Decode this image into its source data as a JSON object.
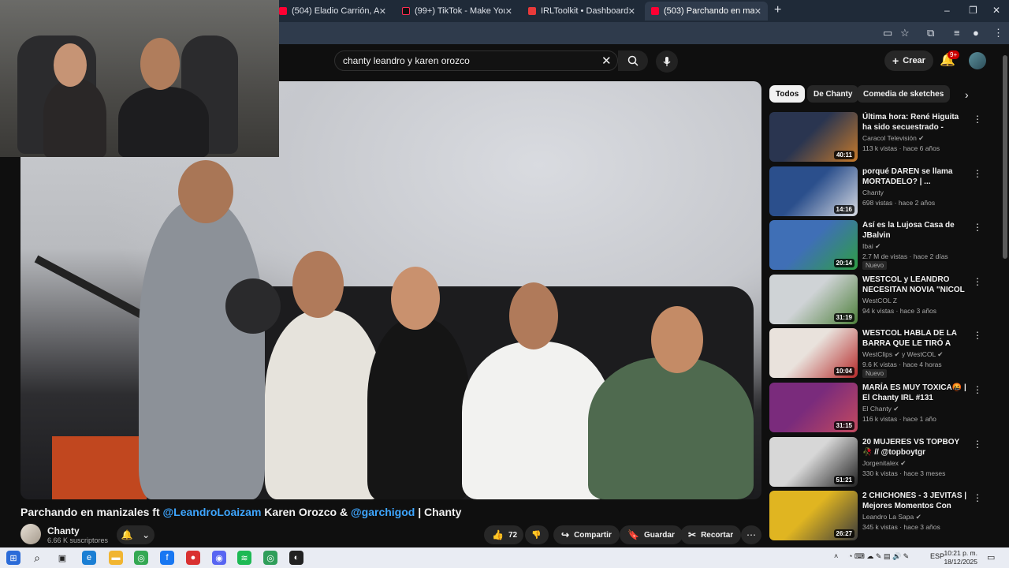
{
  "browser": {
    "tabs": [
      {
        "title": "(504) Eladio Carrión, Arcángel",
        "active": false
      },
      {
        "title": "(99+) TikTok - Make Your Day",
        "active": false
      },
      {
        "title": "IRLToolkit • Dashboard",
        "active": false
      },
      {
        "title": "(503) Parchando en manizales",
        "active": true
      }
    ],
    "new_tab": "+",
    "min": "–",
    "restore": "❐",
    "close": "✕"
  },
  "youtube": {
    "search_query": "chanty leandro y karen orozco",
    "create_label": "Crear",
    "notifications_badge": "9+",
    "video": {
      "title_prefix": "Parchando en manizales ft ",
      "mention1": "@LeandroLoaizam",
      "title_mid": " Karen Orozco & ",
      "mention2": "@garchigod",
      "title_suffix": " | Chanty",
      "channel": "Chanty",
      "subscribers": "6.66 K suscriptores",
      "likes": "72",
      "share_label": "Compartir",
      "save_label": "Guardar",
      "clip_label": "Recortar"
    },
    "chips": [
      "Todos",
      "De Chanty",
      "Comedia de sketches"
    ],
    "recommendations": [
      {
        "title": "Última hora: René Higuita ha sido secuestrado  - Capítulo 3...",
        "channel": "Caracol Televisión ✔",
        "meta": "113 k vistas · hace 6 años",
        "duration": "40:11",
        "badge": "",
        "colors": [
          "#2a3550",
          "#c77a2b"
        ]
      },
      {
        "title": "porqué DAREN se llama MORTADELO? | ...",
        "channel": "Chanty",
        "meta": "698 vistas · hace 2 años",
        "duration": "14:16",
        "badge": "",
        "colors": [
          "#2b4f8c",
          "#d8dbe2"
        ]
      },
      {
        "title": "Así es la Lujosa Casa de JBalvin",
        "channel": "Ibai ✔",
        "meta": "2.7 M de vistas · hace 2 días",
        "duration": "20:14",
        "badge": "Nuevo",
        "colors": [
          "#3f6fb6",
          "#2e9e44"
        ]
      },
      {
        "title": "WESTCOL y LEANDRO NECESITAN NOVIA \"NICOL BT...",
        "channel": "WestCOL Z",
        "meta": "94 k vistas · hace 3 años",
        "duration": "31:19",
        "badge": "",
        "colors": [
          "#cfd3d6",
          "#4d7f3a"
        ]
      },
      {
        "title": "WESTCOL HABLA DE LA BARRA QUE LE TIRÓ A MILICA 😳",
        "channel": "WestClips ✔ y WestCOL ✔",
        "meta": "9.6 K vistas · hace 4 horas",
        "duration": "10:04",
        "badge": "Nuevo",
        "colors": [
          "#e9e2dc",
          "#b52a2a"
        ]
      },
      {
        "title": "MARÍA ES MUY TOXICA🤬 | El Chanty IRL #131",
        "channel": "El Chanty ✔",
        "meta": "116 k vistas · hace 1 año",
        "duration": "31:15",
        "badge": "",
        "colors": [
          "#7a2b7c",
          "#c44a5f"
        ]
      },
      {
        "title": "20 MUJERES VS TOPBOY 🥀 // @topboytgr",
        "channel": "Jorgenitalex ✔",
        "meta": "330 k vistas · hace 3 meses",
        "duration": "51:21",
        "badge": "",
        "colors": [
          "#d7d7d7",
          "#222222"
        ]
      },
      {
        "title": "2 CHICHONES - 3 JEVITAS | Mejores Momentos Con Chant...",
        "channel": "Leandro La Sapa ✔",
        "meta": "345 k vistas · hace 3 años",
        "duration": "26:27",
        "badge": "",
        "colors": [
          "#e0b521",
          "#3b3b3b"
        ]
      }
    ]
  },
  "taskbar": {
    "lang": "ESP",
    "time": "10:21 p. m.",
    "date": "18/12/2025"
  }
}
